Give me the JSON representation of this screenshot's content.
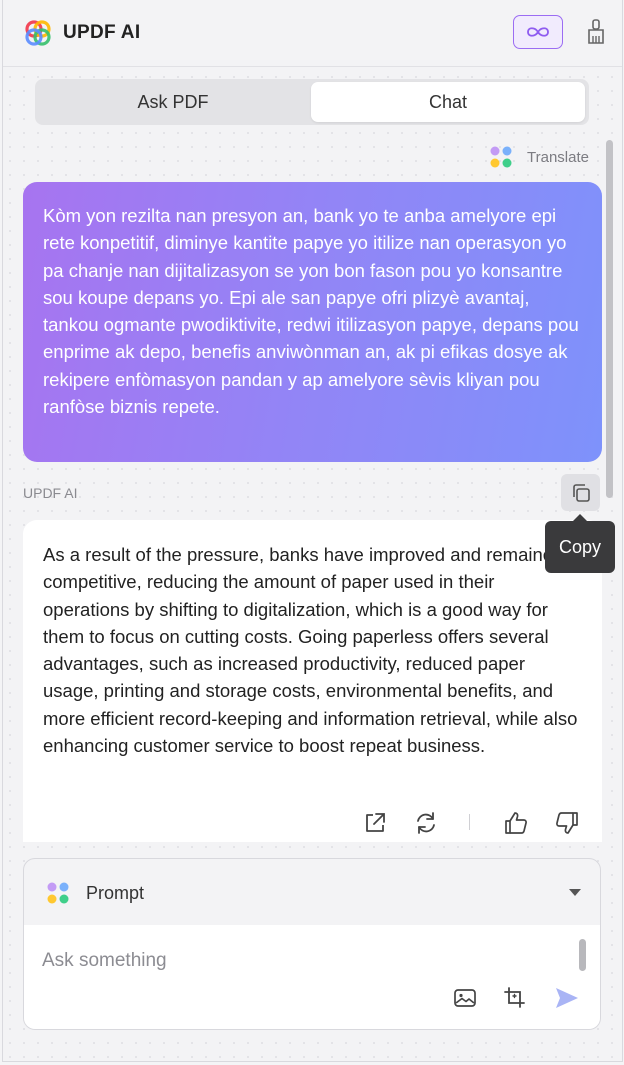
{
  "header": {
    "brand": "UPDF AI",
    "brand_colors": [
      "#f2485a",
      "#ffb800",
      "#35c06d",
      "#5a8cff",
      "#a56cf5"
    ],
    "accent": "#9b6cf3",
    "infinity_icon": "infinity-icon",
    "clear_icon": "broom-icon"
  },
  "tabs": [
    {
      "label": "Ask PDF",
      "active": false
    },
    {
      "label": "Chat",
      "active": true
    }
  ],
  "translate": {
    "label": "Translate"
  },
  "messages": {
    "user_text": "Kòm yon rezilta nan presyon an, bank yo te anba amelyore epi rete konpetitif, diminye kantite papye yo itilize nan operasyon yo pa chanje nan dijitalizasyon se yon bon fason pou yo konsantre sou koupe depans yo. Epi ale san papye ofri plizyè avantaj, tankou ogmante pwodiktivite, redwi itilizasyon papye, depans pou enprime ak depo, benefis anviwònman an, ak pi efikas dosye ak rekipere enfòmasyon pandan y ap amelyore sèvis kliyan pou ranfòse biznis repete.",
    "ai_label": "UPDF AI",
    "ai_text": "As a result of the pressure, banks have improved and remained competitive, reducing the amount of paper used in their operations by shifting to digitalization, which is a good way for them to focus on cutting costs. Going paperless offers several advantages, such as increased productivity, reduced paper usage, printing and storage costs, environmental benefits, and more efficient record-keeping and information retrieval, while also enhancing customer service to boost repeat business."
  },
  "tooltip": {
    "copy": "Copy"
  },
  "composer": {
    "prompt_label": "Prompt",
    "placeholder": "Ask something",
    "value": "",
    "send_color": "#a9b4f5"
  }
}
